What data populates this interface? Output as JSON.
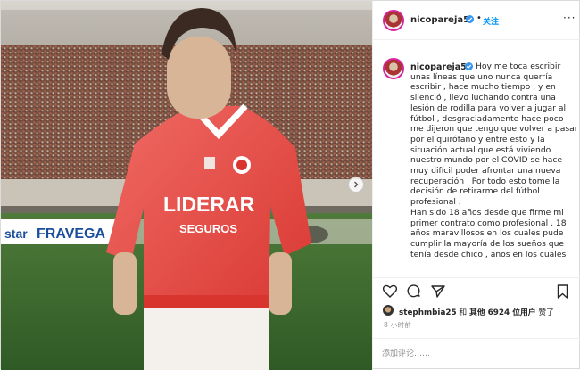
{
  "post": {
    "username": "nicopareja5",
    "follow_label": "关注",
    "header_separator": "•",
    "more_label": "···",
    "photo": {
      "jersey_sponsor_line1": "LIDERAR",
      "jersey_sponsor_line2": "SEGUROS",
      "stadium_banner": "FRAVEGA",
      "banner_prefix": "star"
    },
    "caption": {
      "paragraph1": "Hoy me toca escribir unas líneas que uno nunca querría escribir , hace mucho tiempo , y en silenció , llevo luchando contra una lesión de rodilla para volver a jugar al fútbol , desgraciadamente hace poco me dijeron que tengo que volver a pasar por el quirófano y entre esto y la situación actual que está viviendo nuestro mundo por el COVID se hace muy difícil poder afrontar una nueva recuperación . Por todo esto tome la decisión de retirarme del fútbol profesional .",
      "paragraph2": "Han sido 18 años desde que firme mi primer contrato como profesional , 18 años maravillosos en los cuales pude cumplir la mayoría de los sueños que tenía desde chico , años en los cuales"
    },
    "likes": {
      "liker": "stephmbia25",
      "middle": " 和 ",
      "others": "其他 6924 位用户",
      "suffix": " 赞了"
    },
    "time": "8 小时前",
    "comment": {
      "placeholder": "添加评论……"
    },
    "icons": [
      "heart-icon",
      "comment-icon",
      "share-icon",
      "bookmark-icon",
      "verified-icon",
      "chevron-right-icon"
    ],
    "colors": {
      "link": "#0095f6",
      "verified": "#3897f0",
      "border": "#dbdbdb",
      "text": "#262626",
      "muted": "#8e8e8e",
      "jersey": "#e8413f"
    }
  }
}
